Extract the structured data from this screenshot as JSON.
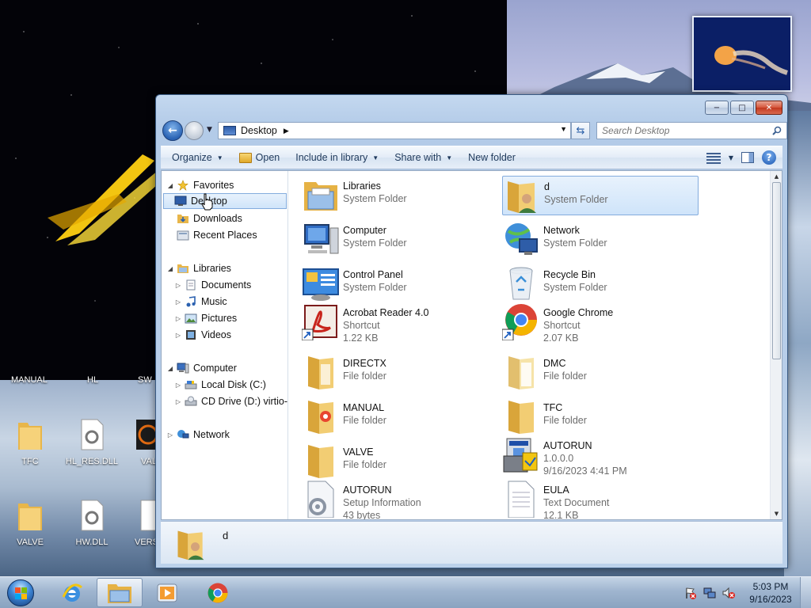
{
  "desktop": {
    "top_labels": [
      "MANUAL",
      "HL",
      "SW"
    ],
    "icons": [
      {
        "label": "TFC",
        "kind": "folder"
      },
      {
        "label": "HL_RES.DLL",
        "kind": "dll"
      },
      {
        "label": "VAL",
        "kind": "valve"
      },
      {
        "label": "VALVE",
        "kind": "folder"
      },
      {
        "label": "HW.DLL",
        "kind": "dll"
      },
      {
        "label": "VERS",
        "kind": "doc"
      }
    ]
  },
  "window": {
    "address": {
      "location": "Desktop"
    },
    "search": {
      "placeholder": "Search Desktop"
    },
    "controls": {
      "minimize": "−",
      "maximize": "□",
      "close": "✕"
    }
  },
  "toolbar": {
    "organize": "Organize",
    "open": "Open",
    "include": "Include in library",
    "share": "Share with",
    "new_folder": "New folder"
  },
  "nav": {
    "favorites": "Favorites",
    "desktop": "Desktop",
    "downloads": "Downloads",
    "recent": "Recent Places",
    "libraries": "Libraries",
    "documents": "Documents",
    "music": "Music",
    "pictures": "Pictures",
    "videos": "Videos",
    "computer": "Computer",
    "local_disk": "Local Disk (C:)",
    "cd_drive": "CD Drive (D:) virtio-w",
    "network": "Network"
  },
  "files": [
    {
      "name": "Libraries",
      "line2": "System Folder",
      "line3": "",
      "icon": "libraries-icon"
    },
    {
      "name": "d",
      "line2": "System Folder",
      "line3": "",
      "icon": "user-folder-icon"
    },
    {
      "name": "Computer",
      "line2": "System Folder",
      "line3": "",
      "icon": "computer-icon"
    },
    {
      "name": "Network",
      "line2": "System Folder",
      "line3": "",
      "icon": "network-icon"
    },
    {
      "name": "Control Panel",
      "line2": "System Folder",
      "line3": "",
      "icon": "control-panel-icon"
    },
    {
      "name": "Recycle Bin",
      "line2": "System Folder",
      "line3": "",
      "icon": "recycle-bin-icon"
    },
    {
      "name": "Acrobat Reader 4.0",
      "line2": "Shortcut",
      "line3": "1.22 KB",
      "icon": "acrobat-icon"
    },
    {
      "name": "Google Chrome",
      "line2": "Shortcut",
      "line3": "2.07 KB",
      "icon": "chrome-icon"
    },
    {
      "name": "DIRECTX",
      "line2": "File folder",
      "line3": "",
      "icon": "folder-icon"
    },
    {
      "name": "DMC",
      "line2": "File folder",
      "line3": "",
      "icon": "folder-icon"
    },
    {
      "name": "MANUAL",
      "line2": "File folder",
      "line3": "",
      "icon": "folder-icon"
    },
    {
      "name": "TFC",
      "line2": "File folder",
      "line3": "",
      "icon": "folder-icon"
    },
    {
      "name": "VALVE",
      "line2": "File folder",
      "line3": "",
      "icon": "folder-icon"
    },
    {
      "name": "AUTORUN",
      "line2": "1.0.0.0",
      "line3": "9/16/2023 4:41 PM",
      "icon": "installer-icon"
    },
    {
      "name": "AUTORUN",
      "line2": "Setup Information",
      "line3": "43 bytes",
      "icon": "setup-info-icon"
    },
    {
      "name": "EULA",
      "line2": "Text Document",
      "line3": "12.1 KB",
      "icon": "text-document-icon"
    }
  ],
  "details": {
    "name": "d"
  },
  "taskbar": {
    "time": "5:03 PM",
    "date": "9/16/2023"
  },
  "colors": {
    "selection_bg": "#cfe4fa",
    "selection_border": "#84acdd",
    "folder": "#e8b64a",
    "secondary_text": "#6d6d6d"
  }
}
